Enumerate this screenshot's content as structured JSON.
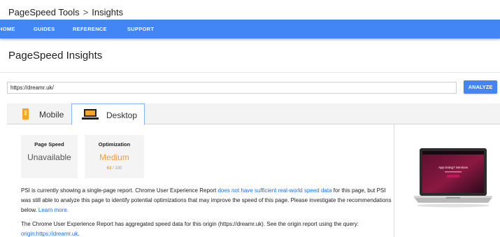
{
  "breadcrumb": {
    "root": "PageSpeed Tools",
    "separator": ">",
    "current": "Insights"
  },
  "nav": {
    "items": [
      "HOME",
      "GUIDES",
      "REFERENCE",
      "SUPPORT"
    ]
  },
  "page": {
    "title": "PageSpeed Insights"
  },
  "search": {
    "url_value": "https://dreamr.uk/",
    "button_label": "ANALYZE"
  },
  "tabs": {
    "mobile": "Mobile",
    "desktop": "Desktop",
    "active": "desktop"
  },
  "scores": {
    "page_speed": {
      "label": "Page Speed",
      "value": "Unavailable"
    },
    "optimization": {
      "label": "Optimization",
      "value": "Medium",
      "score": "63",
      "max": "/ 100"
    }
  },
  "report": {
    "p1_a": "PSI is currently showing a single-page report. Chrome User Experience Report ",
    "p1_link": "does not have sufficient real-world speed data",
    "p1_b": " for this page, but PSI was still able to analyze this page to identify potential optimizations that may improve the speed of this page. Please investigate the recommendations below. ",
    "p1_learn": "Learn more.",
    "p2_a": "The Chrome User Experience Report has aggregated speed data for this origin (https://dreamr.uk). See the origin report using the query: ",
    "p2_link": "origin:https://dreamr.uk",
    "p2_b": "."
  },
  "preview": {
    "heading": "App Doing? Services"
  },
  "colors": {
    "brand_blue": "#4285f4",
    "medium_orange": "#f2a030",
    "link_blue": "#1a73e8"
  }
}
